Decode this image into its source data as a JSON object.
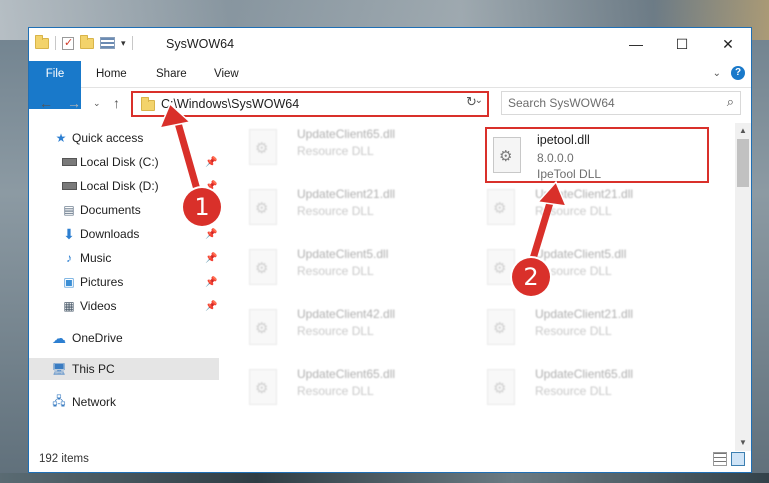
{
  "window": {
    "title": "SysWOW64",
    "controls": {
      "minimize": "—",
      "maximize": "☐",
      "close": "✕"
    }
  },
  "ribbon": {
    "tabs": [
      "File",
      "Home",
      "Share",
      "View"
    ],
    "expand_icon": "chevron-down-icon",
    "help_glyph": "?"
  },
  "address": {
    "path": "C:\\Windows\\SysWOW64",
    "search_placeholder": "Search SysWOW64"
  },
  "sidebar": {
    "quick_access_label": "Quick access",
    "items": [
      {
        "label": "Local Disk (C:)",
        "icon": "drive-icon",
        "pinned": true
      },
      {
        "label": "Local Disk (D:)",
        "icon": "drive-icon",
        "pinned": true
      },
      {
        "label": "Documents",
        "icon": "documents-icon",
        "pinned": true
      },
      {
        "label": "Downloads",
        "icon": "downloads-icon",
        "pinned": true
      },
      {
        "label": "Music",
        "icon": "music-icon",
        "pinned": true
      },
      {
        "label": "Pictures",
        "icon": "pictures-icon",
        "pinned": true
      },
      {
        "label": "Videos",
        "icon": "videos-icon",
        "pinned": true
      }
    ],
    "onedrive_label": "OneDrive",
    "thispc_label": "This PC",
    "network_label": "Network"
  },
  "files": {
    "left_column": [
      {
        "name": "UpdateClient65.dll",
        "type": "Resource DLL"
      },
      {
        "name": "UpdateClient21.dll",
        "type": "Resource DLL"
      },
      {
        "name": "UpdateClient5.dll",
        "type": "Resource DLL"
      },
      {
        "name": "UpdateClient42.dll",
        "type": "Resource DLL"
      },
      {
        "name": "UpdateClient65.dll",
        "type": "Resource DLL"
      }
    ],
    "right_column": [
      {
        "name": "UpdateClient21.dll",
        "type": "Resource DLL"
      },
      {
        "name": "UpdateClient5.dll",
        "type": "Resource DLL"
      },
      {
        "name": "UpdateClient21.dll",
        "type": "Resource DLL"
      },
      {
        "name": "UpdateClient65.dll",
        "type": "Resource DLL"
      }
    ],
    "highlighted": {
      "name": "ipetool.dll",
      "version": "8.0.0.0",
      "description": "IpeTool DLL"
    }
  },
  "status": {
    "item_count": "192 items"
  },
  "annotations": {
    "step1": "1",
    "step2": "2",
    "accent": "#d9302a"
  }
}
